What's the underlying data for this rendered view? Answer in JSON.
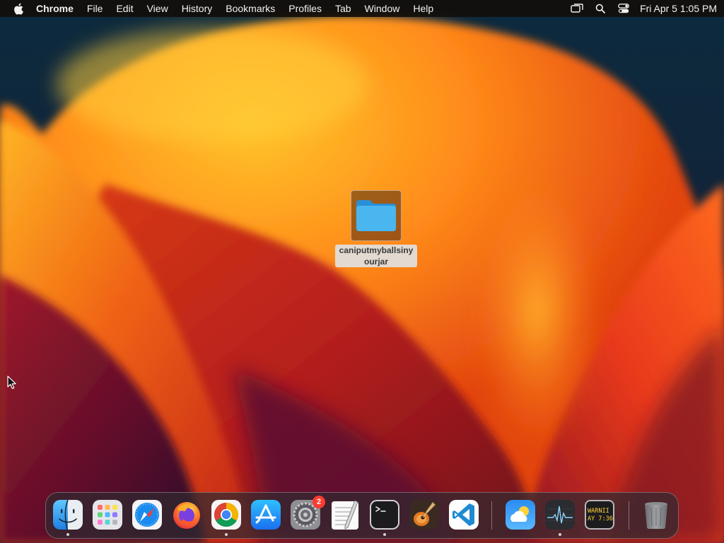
{
  "menubar": {
    "app_name": "Chrome",
    "items": [
      "File",
      "Edit",
      "View",
      "History",
      "Bookmarks",
      "Profiles",
      "Tab",
      "Window",
      "Help"
    ],
    "clock": "Fri Apr 5  1:05 PM"
  },
  "desktop": {
    "folder_name": "caniputmyballsinyourjar"
  },
  "dock": {
    "items": [
      {
        "name": "Finder",
        "icon": "finder-icon",
        "running": true
      },
      {
        "name": "Launchpad",
        "icon": "launchpad-icon",
        "running": false
      },
      {
        "name": "Safari",
        "icon": "safari-icon",
        "running": false
      },
      {
        "name": "Firefox",
        "icon": "firefox-icon",
        "running": false
      },
      {
        "name": "Chrome",
        "icon": "chrome-icon",
        "running": true
      },
      {
        "name": "App Store",
        "icon": "app-store-icon",
        "running": false
      },
      {
        "name": "System Settings",
        "icon": "settings-icon",
        "running": false,
        "badge": "2"
      },
      {
        "name": "TextEdit",
        "icon": "textedit-icon",
        "running": false
      },
      {
        "name": "Terminal",
        "icon": "terminal-icon",
        "running": true
      },
      {
        "name": "GarageBand",
        "icon": "garageband-icon",
        "running": false
      },
      {
        "name": "Visual Studio Code",
        "icon": "vscode-icon",
        "running": false
      },
      {
        "name": "Weather",
        "icon": "weather-icon",
        "running": false
      },
      {
        "name": "Activity Monitor",
        "icon": "activity-monitor-icon",
        "running": true
      },
      {
        "name": "Console",
        "icon": "console-icon",
        "running": false,
        "label_lines": [
          "WARNII",
          "AY 7:36"
        ]
      },
      {
        "name": "Trash",
        "icon": "trash-icon",
        "running": false
      }
    ]
  },
  "colors": {
    "menubar_bg": "#140e0a",
    "folder_blue": "#3aa8e8",
    "badge_red": "#ff3b30"
  }
}
